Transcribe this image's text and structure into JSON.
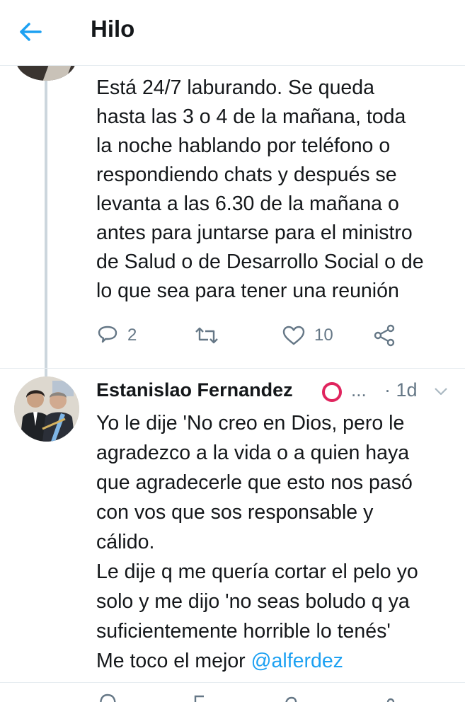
{
  "header": {
    "title": "Hilo",
    "back_icon": "arrow-left-icon",
    "accent_color": "#1da1f2"
  },
  "previous_tweet": {
    "text": "Está 24/7 laburando. Se queda\nhasta las 3 o 4 de la mañana, toda\nla noche hablando por teléfono o\nrespondiendo chats y después se\nlevanta a las 6.30 de la mañana o\nantes para juntarse para el ministro\nde Salud o de Desarrollo Social o de\nlo que sea para tener una reunión",
    "actions": {
      "reply_icon": "reply-icon",
      "reply_count": "2",
      "retweet_icon": "retweet-icon",
      "retweet_count": "",
      "like_icon": "heart-icon",
      "like_count": "10",
      "share_icon": "share-icon"
    }
  },
  "tweet": {
    "author_name": "Estanislao Fernandez",
    "badge_icon": "red-circle-icon",
    "ellipsis": "...",
    "timestamp": "· 1d",
    "caret_icon": "chevron-down-icon",
    "text_part1": "Yo le dije 'No creo en Dios, pero le\nagradezco a la vida o a quien haya\nque agradecerle que esto nos pasó\ncon vos que sos responsable y\ncálido.\nLe dije q me quería cortar el pelo yo\nsolo y me dijo 'no seas boludo q ya\nsuficientemente horrible lo tenés'\nMe toco el mejor ",
    "mention": "@alferdez"
  },
  "colors": {
    "text": "#14171a",
    "secondary": "#657786",
    "link": "#1da1f2",
    "badge": "#e0245e"
  }
}
